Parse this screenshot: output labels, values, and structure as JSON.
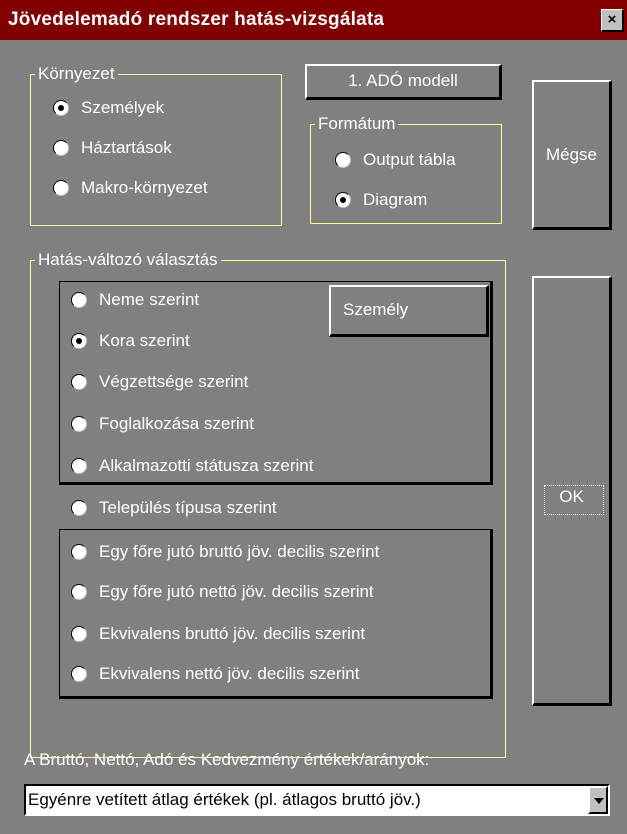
{
  "window": {
    "title": "Jövedelemadó rendszer hatás-vizsgálata",
    "close_label": "×"
  },
  "environment": {
    "legend": "Környezet",
    "options": [
      {
        "label": "Személyek",
        "selected": true
      },
      {
        "label": "Háztartások",
        "selected": false
      },
      {
        "label": "Makro-környezet",
        "selected": false
      }
    ]
  },
  "model_button": "1. ADÓ modell",
  "format": {
    "legend": "Formátum",
    "options": [
      {
        "label": "Output tábla",
        "selected": false
      },
      {
        "label": "Diagram",
        "selected": true
      }
    ]
  },
  "cancel_button": "Mégse",
  "ok_button": "OK",
  "impact": {
    "legend": "Hatás-változó választás",
    "person_button": "Személy",
    "options": [
      {
        "label": "Neme szerint",
        "selected": false
      },
      {
        "label": "Kora szerint",
        "selected": true
      },
      {
        "label": "Végzettsége szerint",
        "selected": false
      },
      {
        "label": "Foglalkozása szerint",
        "selected": false
      },
      {
        "label": "Alkalmazotti státusza szerint",
        "selected": false
      },
      {
        "label": "Település típusa szerint",
        "selected": false
      },
      {
        "label": "Egy főre jutó bruttó jöv. decilis szerint",
        "selected": false
      },
      {
        "label": "Egy főre jutó nettó jöv. decilis szerint",
        "selected": false
      },
      {
        "label": "Ekvivalens bruttó jöv. decilis szerint",
        "selected": false
      },
      {
        "label": "Ekvivalens nettó jöv. decilis szerint",
        "selected": false
      }
    ]
  },
  "values_label": "A Bruttó, Nettó, Adó és Kedvezmény értékek/arányok:",
  "values_select": {
    "value": "Egyénre vetített átlag értékek (pl. átlagos bruttó jöv.)"
  },
  "colors": {
    "titlebar": "#800000",
    "dialog_bg": "#808080",
    "group_border": "#ffff99"
  }
}
